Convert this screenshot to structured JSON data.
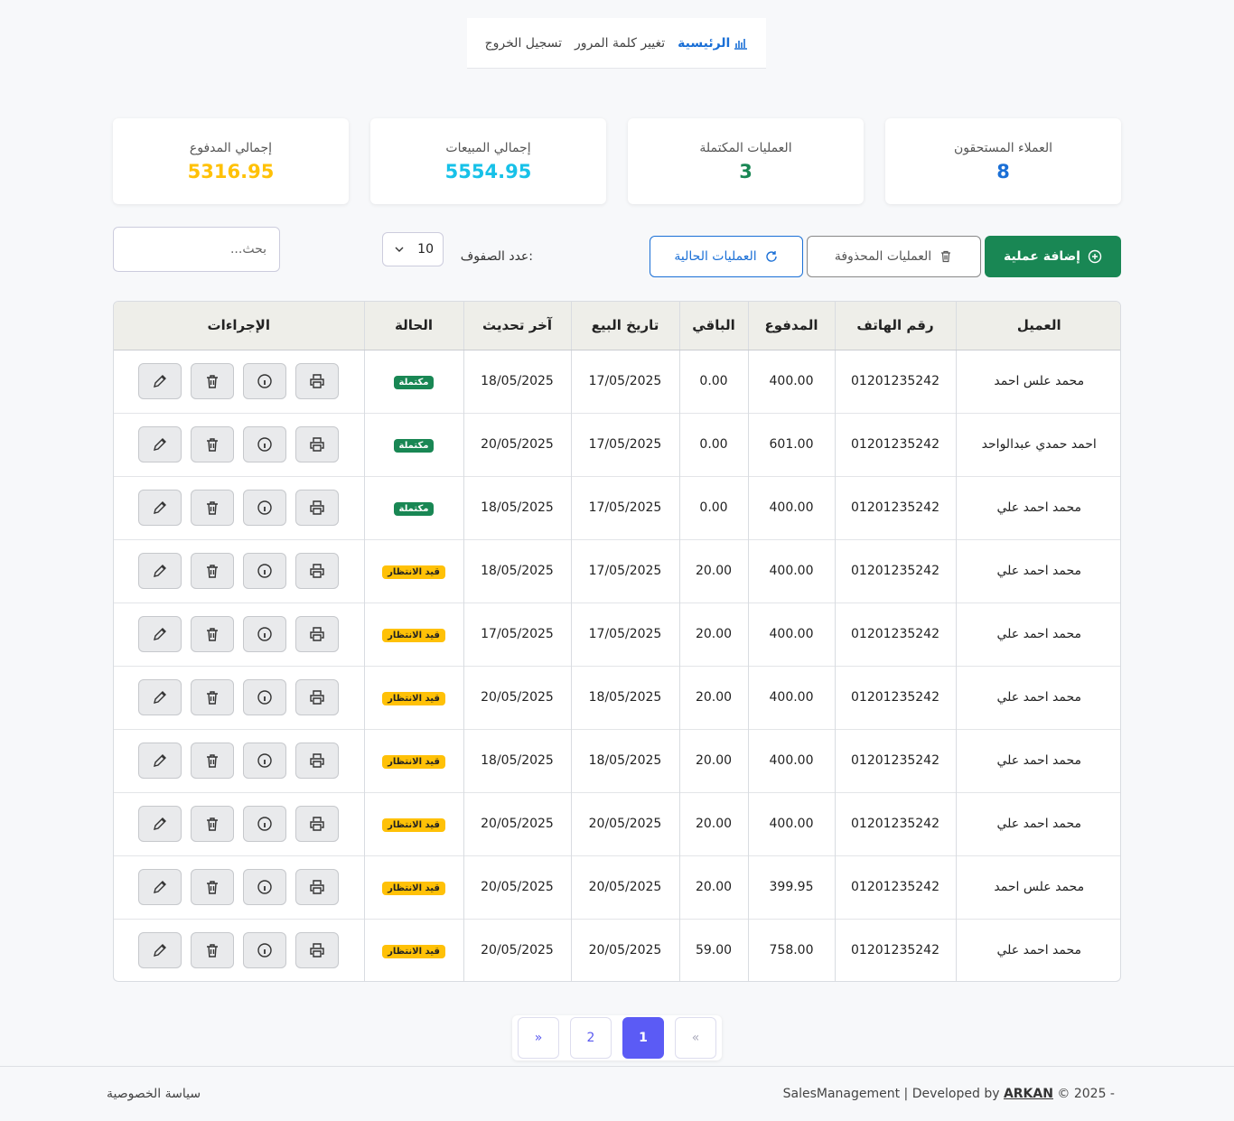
{
  "nav": {
    "home": "الرئيسية",
    "change_password": "تغيير كلمة المرور",
    "logout": "تسجيل الخروج"
  },
  "cards": [
    {
      "label": "العملاء المستحقون",
      "value": "8",
      "color": "#1a6fd6"
    },
    {
      "label": "العمليات المكتملة",
      "value": "3",
      "color": "#198754"
    },
    {
      "label": "إجمالي المبيعات",
      "value": "5554.95",
      "color": "#17c1e8"
    },
    {
      "label": "إجمالي المدفوع",
      "value": "5316.95",
      "color": "#ffc107"
    }
  ],
  "toolbar": {
    "add_label": "إضافة عملية",
    "deleted_label": "العمليات المحذوفة",
    "current_label": "العمليات الحالية",
    "rows_label": "عدد الصفوف:",
    "rows_value": "10",
    "search_placeholder": "بحث..."
  },
  "table": {
    "headers": [
      "العميل",
      "رقم الهاتف",
      "المدفوع",
      "الباقي",
      "تاريخ البيع",
      "آخر تحديث",
      "الحالة",
      "الإجراءات"
    ],
    "rows": [
      {
        "client": "محمد علس احمد",
        "phone": "01201235242",
        "paid": "400.00",
        "remaining": "0.00",
        "sale_date": "17/05/2025",
        "updated": "18/05/2025",
        "status": "مكتملة",
        "status_type": "done"
      },
      {
        "client": "احمد حمدي عبدالواحد",
        "phone": "01201235242",
        "paid": "601.00",
        "remaining": "0.00",
        "sale_date": "17/05/2025",
        "updated": "20/05/2025",
        "status": "مكتملة",
        "status_type": "done"
      },
      {
        "client": "محمد احمد علي",
        "phone": "01201235242",
        "paid": "400.00",
        "remaining": "0.00",
        "sale_date": "17/05/2025",
        "updated": "18/05/2025",
        "status": "مكتملة",
        "status_type": "done"
      },
      {
        "client": "محمد احمد علي",
        "phone": "01201235242",
        "paid": "400.00",
        "remaining": "20.00",
        "sale_date": "17/05/2025",
        "updated": "18/05/2025",
        "status": "قيد الانتظار",
        "status_type": "wait"
      },
      {
        "client": "محمد احمد علي",
        "phone": "01201235242",
        "paid": "400.00",
        "remaining": "20.00",
        "sale_date": "17/05/2025",
        "updated": "17/05/2025",
        "status": "قيد الانتظار",
        "status_type": "wait"
      },
      {
        "client": "محمد احمد علي",
        "phone": "01201235242",
        "paid": "400.00",
        "remaining": "20.00",
        "sale_date": "18/05/2025",
        "updated": "20/05/2025",
        "status": "قيد الانتظار",
        "status_type": "wait"
      },
      {
        "client": "محمد احمد علي",
        "phone": "01201235242",
        "paid": "400.00",
        "remaining": "20.00",
        "sale_date": "18/05/2025",
        "updated": "18/05/2025",
        "status": "قيد الانتظار",
        "status_type": "wait"
      },
      {
        "client": "محمد احمد علي",
        "phone": "01201235242",
        "paid": "400.00",
        "remaining": "20.00",
        "sale_date": "20/05/2025",
        "updated": "20/05/2025",
        "status": "قيد الانتظار",
        "status_type": "wait"
      },
      {
        "client": "محمد علس احمد",
        "phone": "01201235242",
        "paid": "399.95",
        "remaining": "20.00",
        "sale_date": "20/05/2025",
        "updated": "20/05/2025",
        "status": "قيد الانتظار",
        "status_type": "wait"
      },
      {
        "client": "محمد احمد علي",
        "phone": "01201235242",
        "paid": "758.00",
        "remaining": "59.00",
        "sale_date": "20/05/2025",
        "updated": "20/05/2025",
        "status": "قيد الانتظار",
        "status_type": "wait"
      }
    ],
    "action_icons": [
      "pencil-icon",
      "trash-icon",
      "info-icon",
      "printer-icon"
    ]
  },
  "pagination": {
    "prev": "«",
    "pages": [
      "1",
      "2"
    ],
    "active": "1",
    "next": "»"
  },
  "footer": {
    "copyright_prefix": "© 2025 - ",
    "brand": "ARKAN",
    "copyright_suffix": " SalesManagement | Developed by",
    "privacy": "سياسة الخصوصية"
  }
}
